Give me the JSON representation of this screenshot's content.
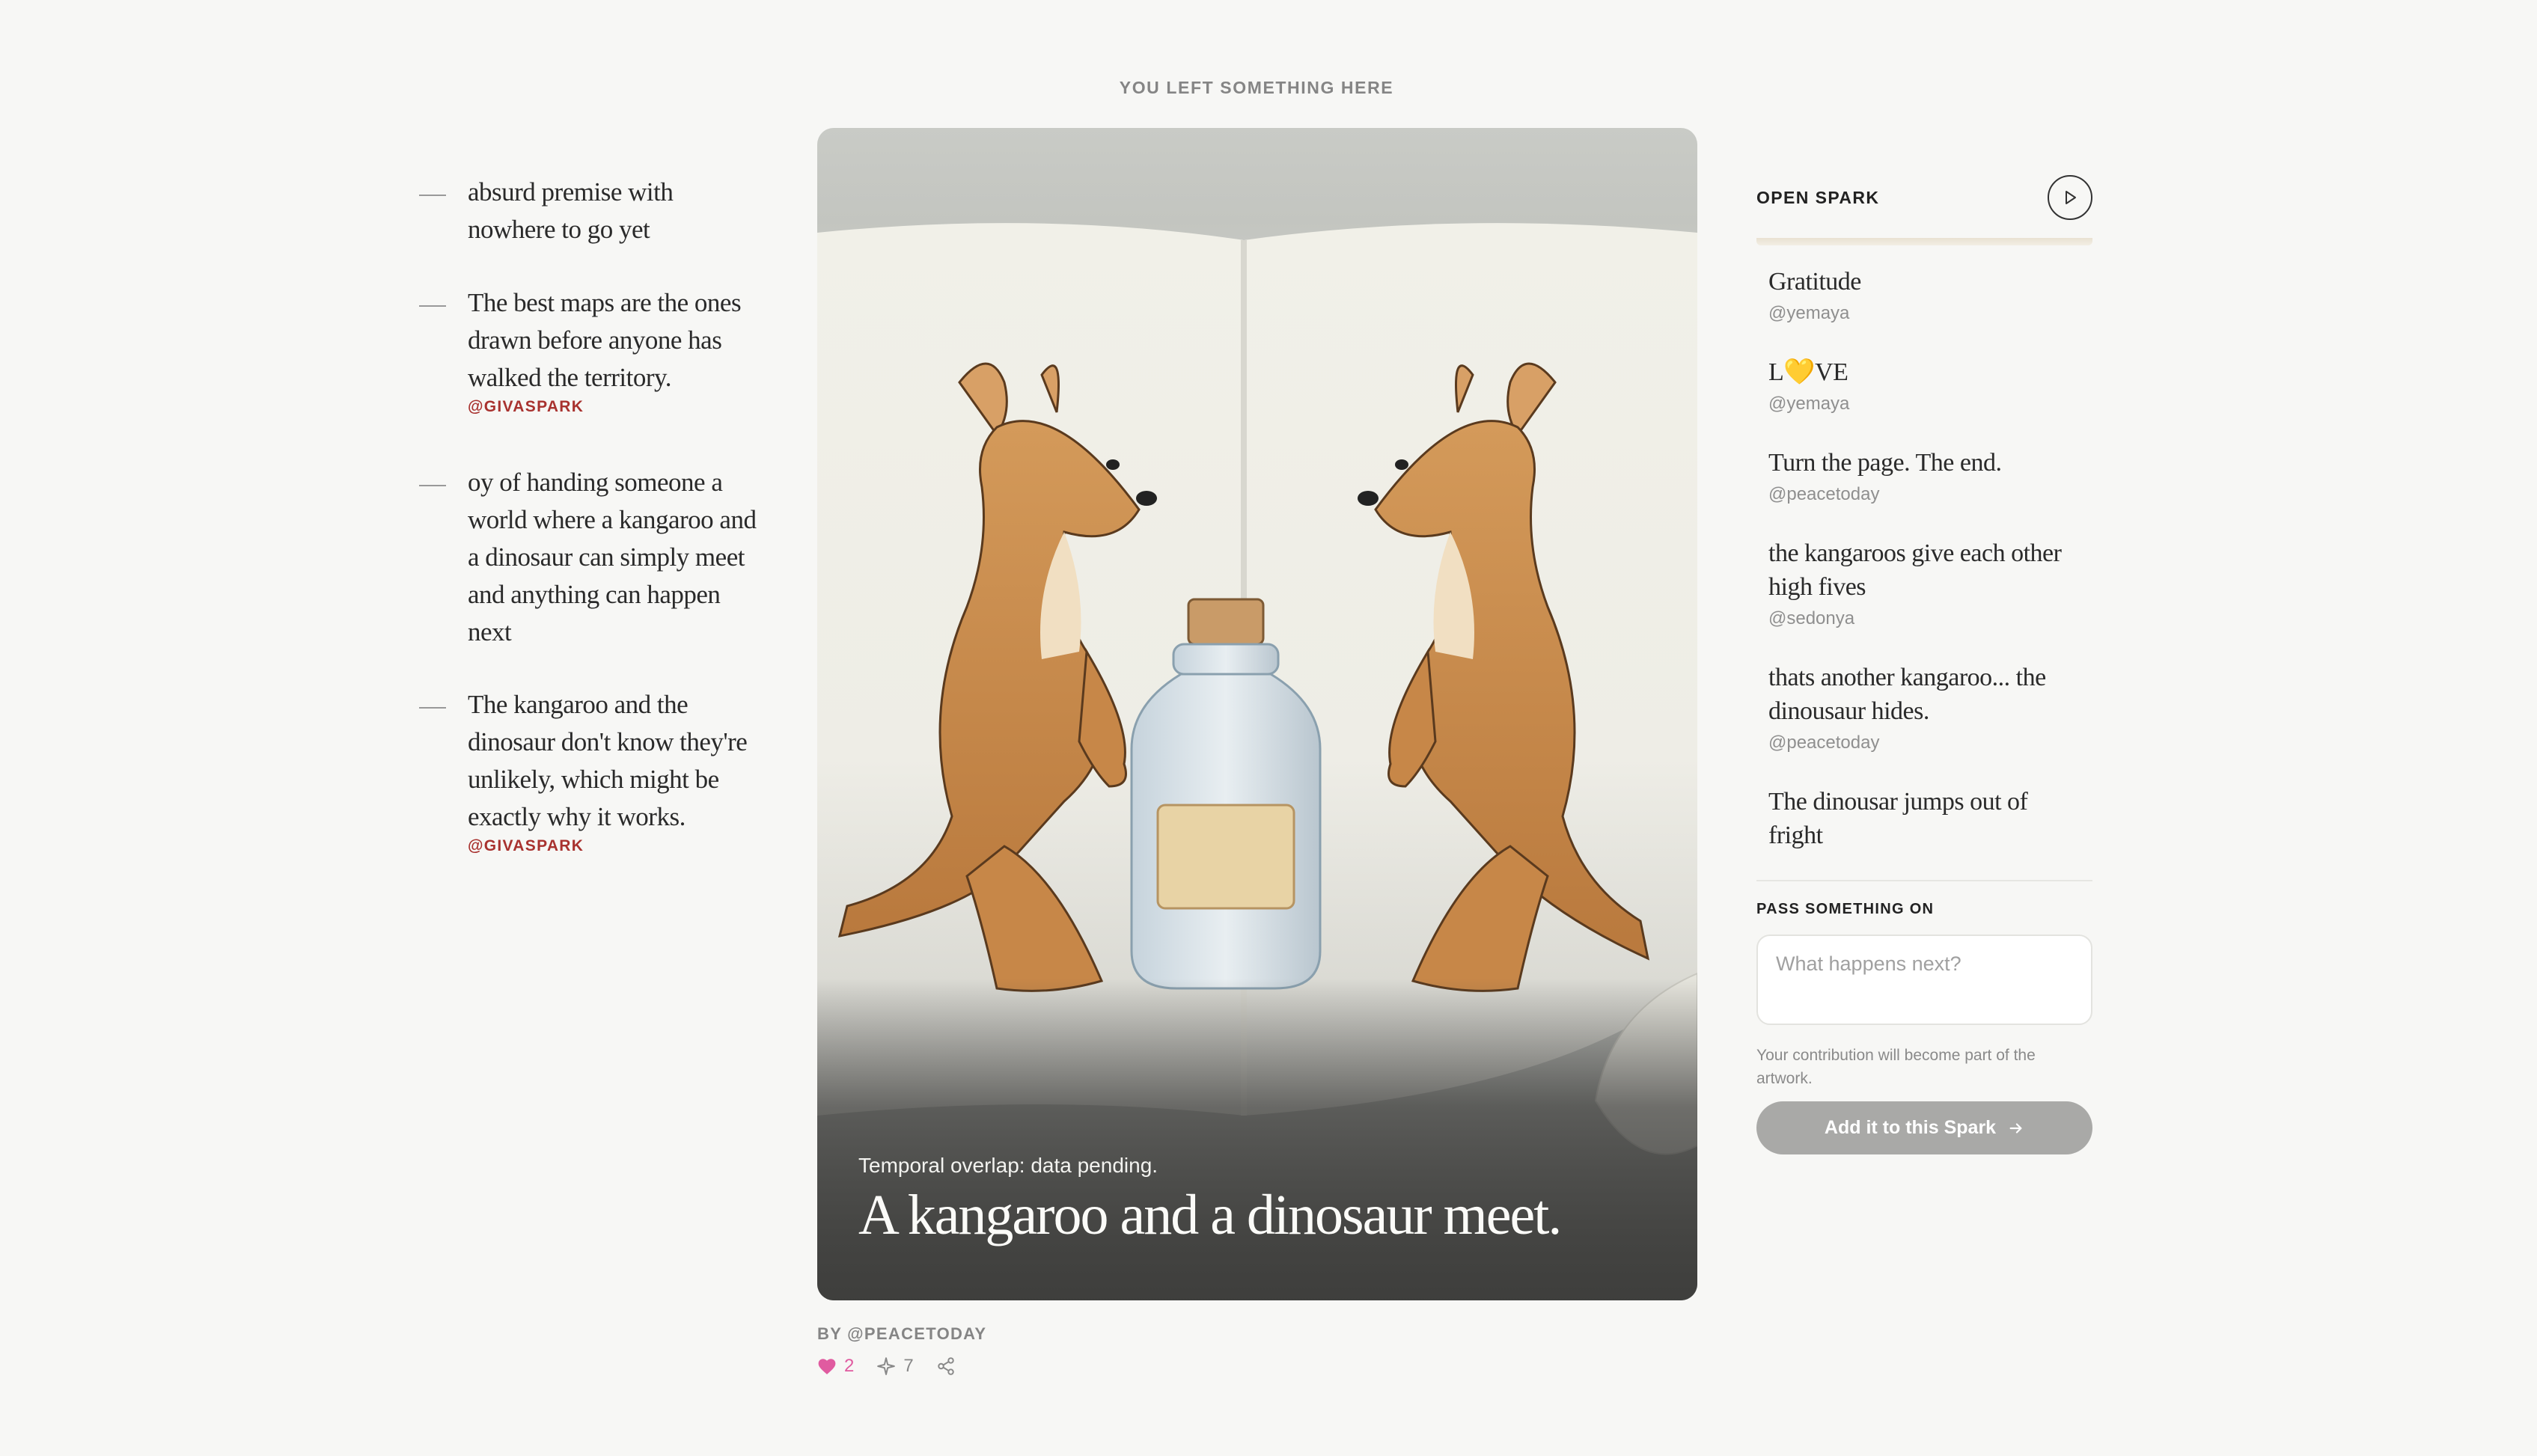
{
  "eyebrow": "YOU LEFT SOMETHING HERE",
  "notes": [
    {
      "text": "absurd premise with nowhere to go yet",
      "author": ""
    },
    {
      "text": "The best maps are the ones drawn before anyone has walked the territory.",
      "author": "@GIVASPARK"
    },
    {
      "text": "oy of handing someone a world where a kangaroo and a dinosaur can simply meet and anything can happen next",
      "author": ""
    },
    {
      "text": "The kangaroo and the dinosaur don't know they're unlikely, which might be exactly why it works.",
      "author": "@GIVASPARK"
    }
  ],
  "card": {
    "subtitle": "Temporal overlap: data pending.",
    "title": "A kangaroo and a dinosaur meet."
  },
  "byline": "BY @PEACETODAY",
  "stats": {
    "likes": "2",
    "sparks": "7"
  },
  "icons": {
    "like": "heart-icon",
    "spark": "sparkle-icon",
    "share": "share-icon",
    "play": "play-icon",
    "arrow": "arrow-right-icon"
  },
  "colors": {
    "like": "#e05ba0",
    "author": "#a8322f",
    "button": "#a9a9a7"
  },
  "panel": {
    "label": "OPEN SPARK",
    "entries": [
      {
        "text": "Gratitude",
        "user": "@yemaya"
      },
      {
        "text": "L💛VE",
        "user": "@yemaya"
      },
      {
        "text": "Turn the page. The end.",
        "user": "@peacetoday"
      },
      {
        "text": "the kangaroos give each other high fives",
        "user": "@sedonya"
      },
      {
        "text": "thats another kangaroo... the dinousaur hides.",
        "user": "@peacetoday"
      },
      {
        "text": "The dinousar jumps out of fright",
        "user": ""
      }
    ],
    "pass_label": "PASS SOMETHING ON",
    "input_placeholder": "What happens next?",
    "input_value": "",
    "helper": "Your contribution will become part of the artwork.",
    "button": "Add it to this Spark"
  }
}
